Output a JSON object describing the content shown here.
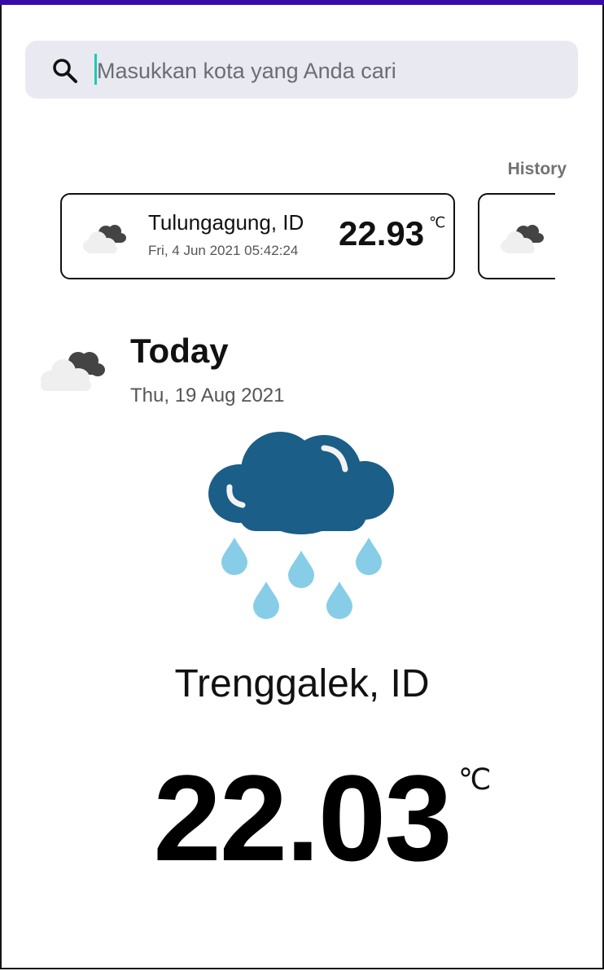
{
  "search": {
    "placeholder": "Masukkan kota yang Anda cari",
    "icon": "search-icon"
  },
  "history": {
    "title": "History",
    "items": [
      {
        "city": "Tulungagung, ID",
        "datetime": "Fri, 4 Jun 2021 05:42:24",
        "temp": "22.93",
        "unit": "℃",
        "icon": "cloudy-icon"
      },
      {
        "icon": "cloudy-icon"
      }
    ]
  },
  "today": {
    "label": "Today",
    "date": "Thu, 19 Aug 2021",
    "icon": "cloudy-icon"
  },
  "current": {
    "city": "Trenggalek, ID",
    "temp": "22.03",
    "unit": "℃",
    "condition_icon": "rain-cloud-icon"
  },
  "colors": {
    "accent_bar": "#3a0aa8",
    "cloud_blue": "#1b5e88",
    "rain_drop": "#87cde8",
    "search_bg": "#e9eaf1"
  }
}
